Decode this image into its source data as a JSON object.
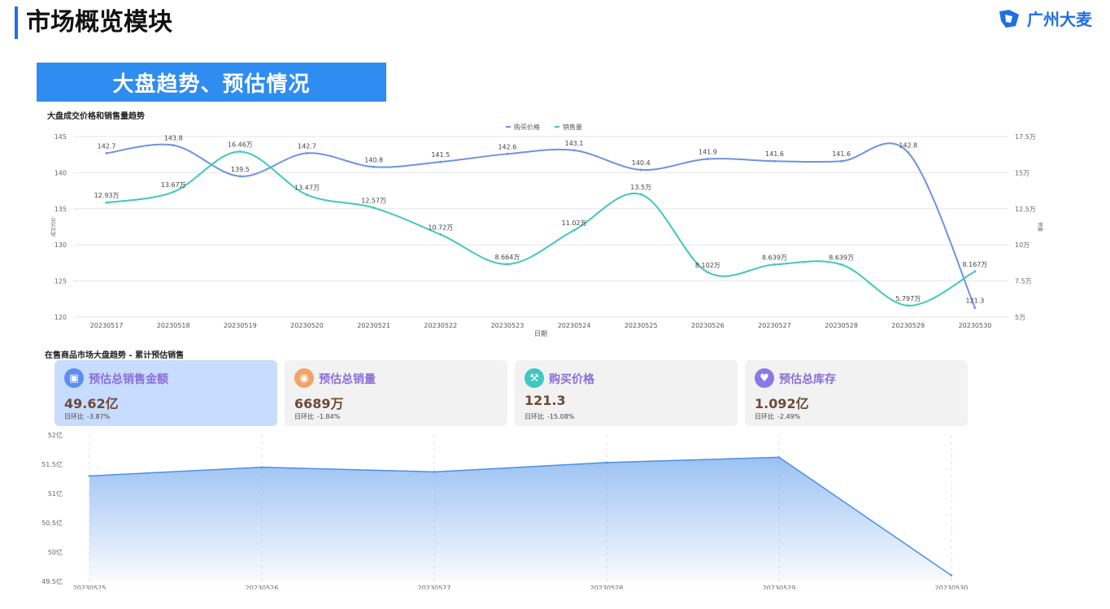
{
  "header": {
    "page_title": "市场概览模块",
    "brand": "广州大麦",
    "brand_color": "#1f6fe5"
  },
  "banner": {
    "text": "大盘趋势、预估情况",
    "color": "#2f8cf0"
  },
  "chart_data": [
    {
      "type": "line",
      "title": "大盘成交价格和销售量趋势",
      "xlabel": "日期",
      "ylabel": "成交均价",
      "y2label": "销量",
      "categories": [
        "20230517",
        "20230518",
        "20230519",
        "20230520",
        "20230521",
        "20230522",
        "20230523",
        "20230524",
        "20230525",
        "20230526",
        "20230527",
        "20230528",
        "20230529",
        "20230530"
      ],
      "ylim": [
        120,
        145
      ],
      "yticks": [
        "145",
        "140",
        "135",
        "130",
        "125",
        "120"
      ],
      "y2lim": [
        5,
        17.5
      ],
      "y2ticks": [
        "17.5万",
        "15万",
        "12.5万",
        "10万",
        "7.5万",
        "5万"
      ],
      "legend_position": "top-center",
      "series": [
        {
          "name": "购买价格",
          "axis": "left",
          "color": "#6e93e0",
          "values": [
            142.7,
            143.8,
            139.5,
            142.7,
            140.8,
            141.5,
            142.6,
            143.1,
            140.4,
            141.9,
            141.6,
            141.6,
            142.8,
            121.3
          ],
          "labels": [
            "142.7",
            "143.8",
            "139.5",
            "142.7",
            "140.8",
            "141.5",
            "142.6",
            "143.1",
            "140.4",
            "141.9",
            "141.6",
            "141.6",
            "142.8",
            "121.3"
          ]
        },
        {
          "name": "销售量",
          "axis": "right",
          "color": "#3ec8c0",
          "values": [
            12.93,
            13.67,
            16.46,
            13.47,
            12.57,
            10.72,
            8.664,
            11.02,
            13.5,
            8.102,
            8.639,
            8.639,
            5.797,
            8.167
          ],
          "labels": [
            "12.93万",
            "13.67万",
            "16.46万",
            "13.47万",
            "12.57万",
            "10.72万",
            "8.664万",
            "11.02万",
            "13.5万",
            "8.102万",
            "8.639万",
            "8.639万",
            "5.797万",
            "8.167万"
          ]
        }
      ]
    },
    {
      "type": "area",
      "title": "在售商品市场大盘趋势 - 累计预估销售",
      "categories": [
        "20230525",
        "20230526",
        "20230527",
        "20230528",
        "20230529",
        "20230530"
      ],
      "ylim": [
        49.5,
        52
      ],
      "yticks": [
        "52亿",
        "51.5亿",
        "51亿",
        "50.5亿",
        "50亿",
        "49.5亿"
      ],
      "color": "#4a8fe8",
      "series": [
        {
          "values": [
            51.3,
            51.45,
            51.37,
            51.53,
            51.62,
            49.6
          ]
        }
      ]
    }
  ],
  "cards": [
    {
      "label": "预估总销售金额",
      "value": "49.62亿",
      "cmp_label": "日环比",
      "cmp_value": "-3.87%",
      "icon": "wallet-icon",
      "icon_color": "#5b8ef0",
      "active": true
    },
    {
      "label": "预估总销量",
      "value": "6689万",
      "cmp_label": "日环比",
      "cmp_value": "-1.84%",
      "icon": "eye-icon",
      "icon_color": "#f0a468",
      "active": false
    },
    {
      "label": "购买价格",
      "value": "121.3",
      "cmp_label": "日环比",
      "cmp_value": "-15.08%",
      "icon": "hammer-icon",
      "icon_color": "#3ec8c0",
      "active": false
    },
    {
      "label": "预估总库存",
      "value": "1.092亿",
      "cmp_label": "日环比",
      "cmp_value": "-2.49%",
      "icon": "box-icon",
      "icon_color": "#8a78e8",
      "active": false
    }
  ]
}
